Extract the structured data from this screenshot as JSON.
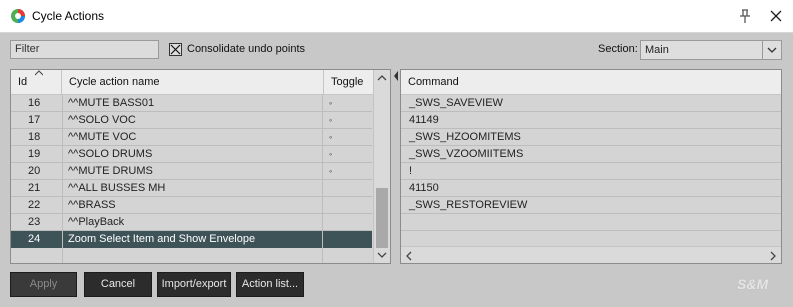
{
  "window": {
    "title": "Cycle Actions"
  },
  "toolbar": {
    "filter_placeholder": "Filter",
    "consolidate_label": "Consolidate undo points",
    "consolidate_checked": true,
    "section_label": "Section:",
    "section_value": "Main"
  },
  "left_table": {
    "headers": {
      "id": "Id",
      "name": "Cycle action name",
      "toggle": "Toggle"
    },
    "rows": [
      {
        "id": "16",
        "name": "^^MUTE BASS01",
        "toggle": "◦"
      },
      {
        "id": "17",
        "name": "^^SOLO VOC",
        "toggle": "◦"
      },
      {
        "id": "18",
        "name": "^^MUTE VOC",
        "toggle": "◦"
      },
      {
        "id": "19",
        "name": "^^SOLO DRUMS",
        "toggle": "◦"
      },
      {
        "id": "20",
        "name": "^^MUTE DRUMS",
        "toggle": "◦"
      },
      {
        "id": "21",
        "name": "^^ALL BUSSES MH",
        "toggle": ""
      },
      {
        "id": "22",
        "name": "^^BRASS",
        "toggle": ""
      },
      {
        "id": "23",
        "name": "^^PlayBack",
        "toggle": ""
      },
      {
        "id": "24",
        "name": "Zoom Select Item and Show Envelope",
        "toggle": ""
      }
    ],
    "selected_row": 8
  },
  "right_table": {
    "header": "Command",
    "rows": [
      "_SWS_SAVEVIEW",
      "41149",
      "_SWS_HZOOMITEMS",
      "_SWS_VZOOMIITEMS",
      "!",
      "41150",
      "_SWS_RESTOREVIEW",
      "",
      "",
      ""
    ]
  },
  "buttons": {
    "apply": "Apply",
    "cancel": "Cancel",
    "import_export": "Import/export",
    "action_list": "Action list..."
  },
  "branding": {
    "logo": "S&M"
  },
  "colors": {
    "selected_row": "#3e5358",
    "button_bg": "#2c2c2c",
    "panel_bg": "#c8c8c8"
  }
}
